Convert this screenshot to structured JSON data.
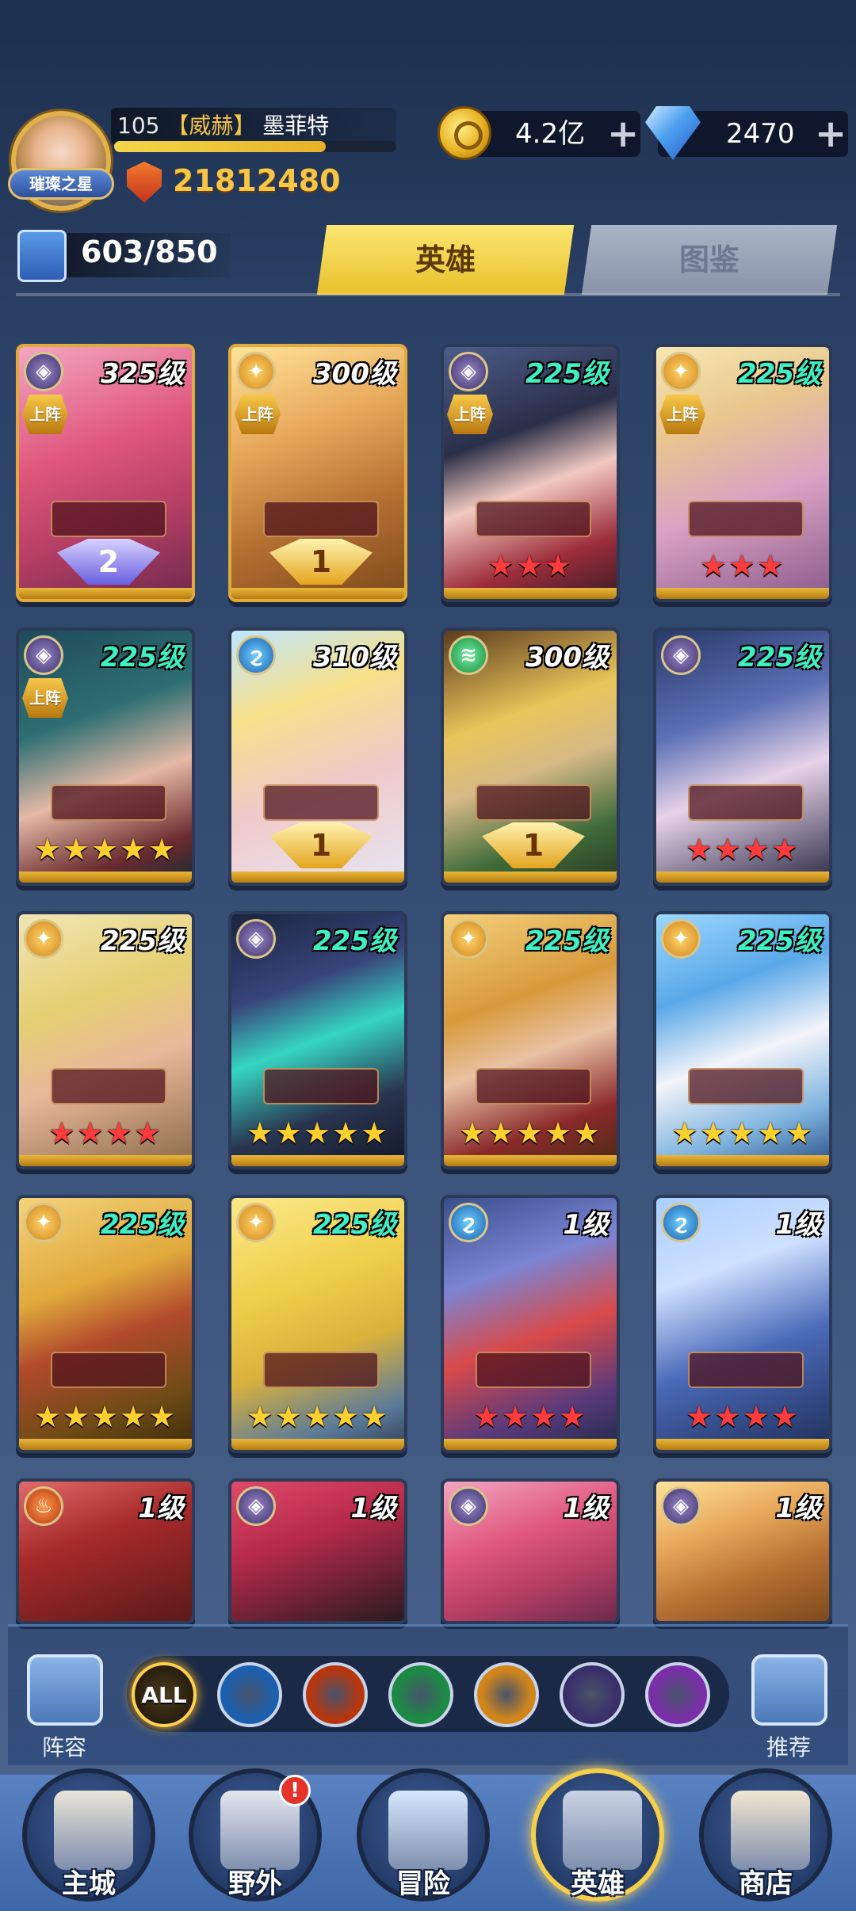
{
  "player": {
    "level": "105",
    "guild": "【威赫】",
    "name": "墨菲特",
    "title_badge": "璀璨之星",
    "xp_progress": 0.75,
    "power": "21812480"
  },
  "resources": {
    "gold": "4.2亿",
    "gems": "2470"
  },
  "hero_count": "603/850",
  "tabs": [
    {
      "label": "英雄",
      "active": true
    },
    {
      "label": "图鉴",
      "active": false
    }
  ],
  "deploy_label": "上阵",
  "heroes": [
    {
      "level": "325级",
      "level_color": "white",
      "element": "dark",
      "deployed": true,
      "stars": "",
      "rank": "2",
      "rank_style": "blue"
    },
    {
      "level": "300级",
      "level_color": "white",
      "element": "gold",
      "deployed": true,
      "stars": "",
      "rank": "1",
      "rank_style": "gold"
    },
    {
      "level": "225级",
      "level_color": "teal",
      "element": "dark",
      "deployed": true,
      "stars": "★★★",
      "star_color": "red"
    },
    {
      "level": "225级",
      "level_color": "teal",
      "element": "gold",
      "deployed": true,
      "stars": "★★★",
      "star_color": "red"
    },
    {
      "level": "225级",
      "level_color": "teal",
      "element": "dark",
      "deployed": true,
      "stars": "★★★★★",
      "star_color": "yellow"
    },
    {
      "level": "310级",
      "level_color": "white",
      "element": "water",
      "deployed": false,
      "stars": "",
      "rank": "1",
      "rank_style": "gold"
    },
    {
      "level": "300级",
      "level_color": "white",
      "element": "wind",
      "deployed": false,
      "stars": "",
      "rank": "1",
      "rank_style": "gold"
    },
    {
      "level": "225级",
      "level_color": "teal",
      "element": "dark",
      "deployed": false,
      "stars": "★★★★",
      "star_color": "red"
    },
    {
      "level": "225级",
      "level_color": "white",
      "element": "gold",
      "deployed": false,
      "stars": "★★★★",
      "star_color": "red"
    },
    {
      "level": "225级",
      "level_color": "teal",
      "element": "dark",
      "deployed": false,
      "stars": "★★★★★",
      "star_color": "yellow"
    },
    {
      "level": "225级",
      "level_color": "teal",
      "element": "gold",
      "deployed": false,
      "stars": "★★★★★",
      "star_color": "yellow"
    },
    {
      "level": "225级",
      "level_color": "teal",
      "element": "gold",
      "deployed": false,
      "stars": "★★★★★",
      "star_color": "yellow"
    },
    {
      "level": "225级",
      "level_color": "teal",
      "element": "gold",
      "deployed": false,
      "stars": "★★★★★",
      "star_color": "yellow"
    },
    {
      "level": "225级",
      "level_color": "teal",
      "element": "gold",
      "deployed": false,
      "stars": "★★★★★",
      "star_color": "yellow"
    },
    {
      "level": "1级",
      "level_color": "white",
      "element": "water",
      "deployed": false,
      "stars": "★★★★",
      "star_color": "red"
    },
    {
      "level": "1级",
      "level_color": "white",
      "element": "water",
      "deployed": false,
      "stars": "★★★★",
      "star_color": "red"
    },
    {
      "level": "1级",
      "level_color": "white",
      "element": "fire",
      "deployed": false,
      "stars": "",
      "star_color": "red"
    },
    {
      "level": "1级",
      "level_color": "white",
      "element": "dark",
      "deployed": false,
      "stars": "",
      "star_color": "red"
    },
    {
      "level": "1级",
      "level_color": "white",
      "element": "dark",
      "deployed": false,
      "stars": "",
      "star_color": "red"
    },
    {
      "level": "1级",
      "level_color": "white",
      "element": "dark",
      "deployed": false,
      "stars": "",
      "star_color": "red"
    }
  ],
  "filters": [
    {
      "name": "all",
      "label": "ALL",
      "color": "#2a1c08",
      "active": true
    },
    {
      "name": "water",
      "label": "",
      "color": "#1b5fae",
      "active": false
    },
    {
      "name": "fire",
      "label": "",
      "color": "#b8360e",
      "active": false
    },
    {
      "name": "wind",
      "label": "",
      "color": "#1c8a44",
      "active": false
    },
    {
      "name": "light",
      "label": "",
      "color": "#d2861a",
      "active": false
    },
    {
      "name": "dark",
      "label": "",
      "color": "#3b2f6a",
      "active": false
    },
    {
      "name": "void",
      "label": "",
      "color": "#7a2fa8",
      "active": false
    }
  ],
  "side_buttons": {
    "lineup": "阵容",
    "recommend": "推荐"
  },
  "nav": [
    {
      "label": "主城",
      "active": false
    },
    {
      "label": "野外",
      "active": false,
      "badge": "!"
    },
    {
      "label": "冒险",
      "active": false
    },
    {
      "label": "英雄",
      "active": true
    },
    {
      "label": "商店",
      "active": false
    }
  ],
  "colors": {
    "accent_gold": "#f7c646",
    "level_teal": "#3ff0c5",
    "star_red": "#ff3b3b",
    "star_yellow": "#ffd02e"
  }
}
